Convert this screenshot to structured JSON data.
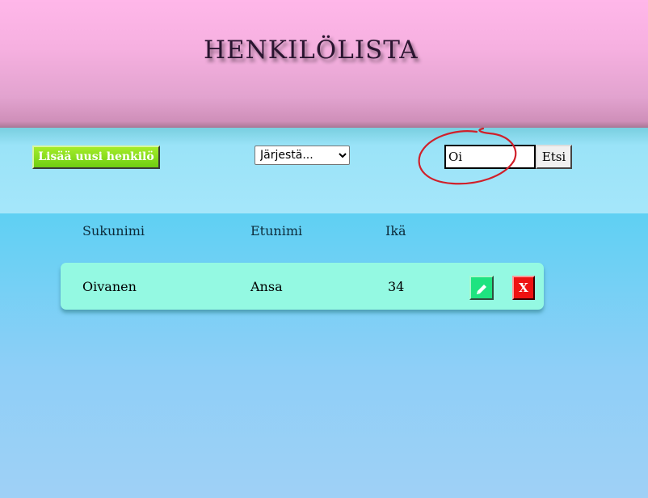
{
  "header": {
    "title": "HENKILÖLISTA"
  },
  "toolbar": {
    "add_label": "Lisää uusi henkilö",
    "sort": {
      "selected": "Järjestä...",
      "options": [
        "Järjestä..."
      ]
    },
    "search": {
      "value": "Oi"
    },
    "search_button_label": "Etsi"
  },
  "table": {
    "columns": [
      "Sukunimi",
      "Etunimi",
      "Ikä"
    ],
    "rows": [
      {
        "sukunimi": "Oivanen",
        "etunimi": "Ansa",
        "ika": "34",
        "delete_label": "X"
      }
    ]
  },
  "icons": {
    "edit": "pencil-icon",
    "sort_arrow": "chevron-down-icon",
    "annotation": "red-circle-annotation"
  },
  "colors": {
    "header_pink": "#ffb7e9",
    "add_button_green": "#8ee01f",
    "row_mint": "#94f9e2",
    "edit_green": "#1fe380",
    "delete_red": "#ee1212",
    "annotation_red": "#d0202a"
  }
}
